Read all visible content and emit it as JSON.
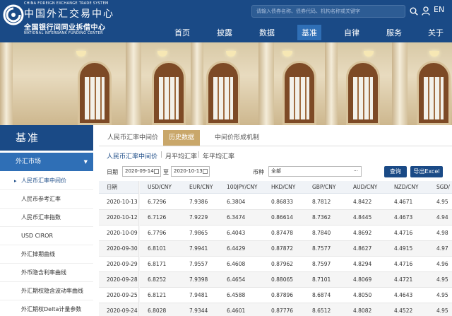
{
  "header": {
    "en_title_top": "CHINA FOREIGN EXCHANGE TRADE SYSTEM",
    "cn_title_top": "中国外汇交易中心",
    "cn_title_bottom": "全国银行间同业拆借中心",
    "en_title_bottom": "NATIONAL INTERBANK FUNDING CENTER",
    "search_placeholder": "请输入债券名称、债券代码、机构名称或关键字",
    "lang": "EN",
    "nav": [
      "首页",
      "披露",
      "数据",
      "基准",
      "自律",
      "服务",
      "关于"
    ],
    "active_nav": "基准",
    "colors": {
      "brand": "#1a4a86",
      "accent": "#2f6fb6",
      "tab_active": "#c9a76a"
    }
  },
  "sidebar": {
    "title": "基准",
    "category": "外汇市场",
    "items": [
      "人民币汇率中间价",
      "人民币参考汇率",
      "人民币汇率指数",
      "USD CIROR",
      "外汇掉期曲线",
      "外币隐含利率曲线",
      "外汇期权隐含波动率曲线",
      "外汇期权Delta计量参数"
    ]
  },
  "tabs": [
    "人民币汇率中间价",
    "历史数据",
    "中间价形成机制"
  ],
  "active_tab": "历史数据",
  "subtabs": [
    "人民币汇率中间价",
    "月平均汇率",
    "年平均汇率"
  ],
  "filter": {
    "date_label": "日期",
    "start_date": "2020-09-14",
    "sep": "至",
    "end_date": "2020-10-13",
    "currency_label": "币种",
    "currency_value": "全部",
    "search_btn": "查询",
    "export_btn": "导出Excel"
  },
  "table": {
    "headers": [
      "日期",
      "USD/CNY",
      "EUR/CNY",
      "100JPY/CNY",
      "HKD/CNY",
      "GBP/CNY",
      "AUD/CNY",
      "NZD/CNY",
      "SGD/"
    ],
    "rows": [
      [
        "2020-10-13",
        "6.7296",
        "7.9386",
        "6.3804",
        "0.86833",
        "8.7812",
        "4.8422",
        "4.4671",
        "4.95"
      ],
      [
        "2020-10-12",
        "6.7126",
        "7.9229",
        "6.3474",
        "0.86614",
        "8.7362",
        "4.8445",
        "4.4673",
        "4.94"
      ],
      [
        "2020-10-09",
        "6.7796",
        "7.9865",
        "6.4043",
        "0.87478",
        "8.7840",
        "4.8692",
        "4.4716",
        "4.98"
      ],
      [
        "2020-09-30",
        "6.8101",
        "7.9941",
        "6.4429",
        "0.87872",
        "8.7577",
        "4.8627",
        "4.4915",
        "4.97"
      ],
      [
        "2020-09-29",
        "6.8171",
        "7.9557",
        "6.4608",
        "0.87962",
        "8.7597",
        "4.8294",
        "4.4716",
        "4.96"
      ],
      [
        "2020-09-28",
        "6.8252",
        "7.9398",
        "6.4654",
        "0.88065",
        "8.7101",
        "4.8069",
        "4.4721",
        "4.95"
      ],
      [
        "2020-09-25",
        "6.8121",
        "7.9481",
        "6.4588",
        "0.87896",
        "8.6874",
        "4.8050",
        "4.4643",
        "4.95"
      ],
      [
        "2020-09-24",
        "6.8028",
        "7.9344",
        "6.4601",
        "0.87776",
        "8.6512",
        "4.8082",
        "4.4522",
        "4.95"
      ]
    ]
  }
}
